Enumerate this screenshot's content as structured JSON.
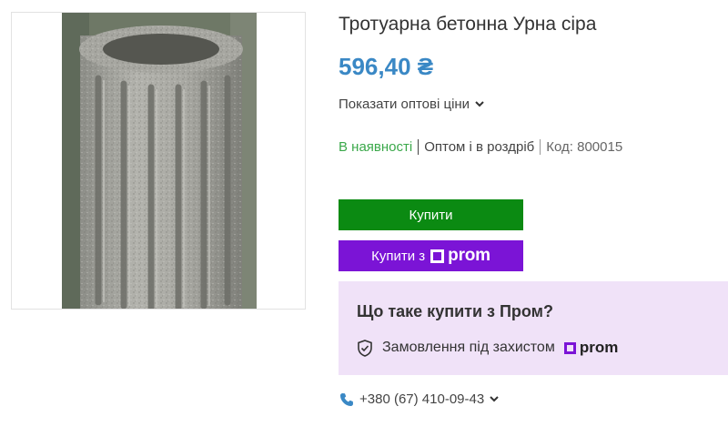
{
  "product": {
    "title": "Тротуарна бетонна Урна сіра",
    "price": "596,40 ₴",
    "wholesale_link": "Показати оптові ціни",
    "availability": "В наявності",
    "sale_mode": "Оптом і в роздріб",
    "code": "Код: 800015",
    "image_icon": "concrete-urn-photo"
  },
  "actions": {
    "buy_label": "Купити",
    "buy_prom_label": "Купити з",
    "prom_brand": "prom"
  },
  "promo": {
    "title": "Що таке купити з Пром?",
    "protection_text": "Замовлення під захистом",
    "brand": "prom"
  },
  "contact": {
    "phone": "+380 (67) 410-09-43"
  },
  "colors": {
    "price": "#3a88c5",
    "availability": "#3aa84a",
    "buy_button": "#0b8a12",
    "prom_button": "#7b14d6",
    "promo_bg": "#f0e2f8",
    "phone_icon": "#3a88c5"
  }
}
